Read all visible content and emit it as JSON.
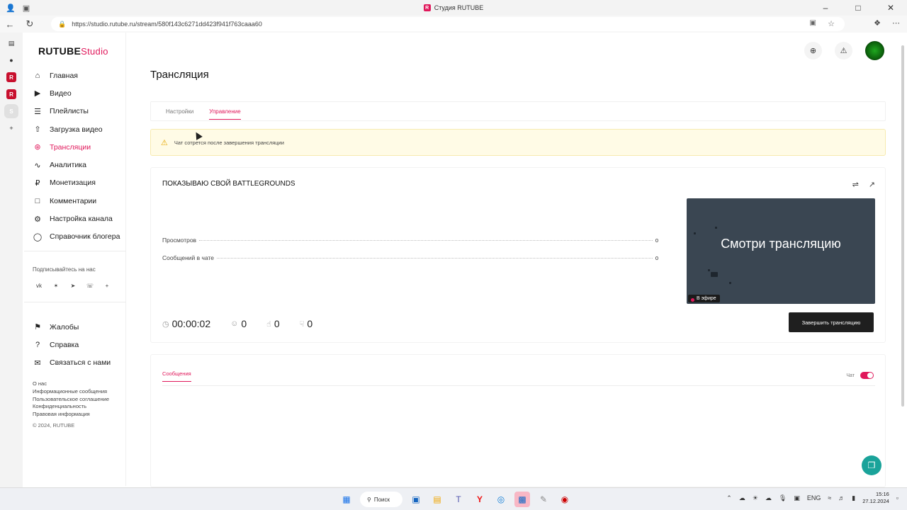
{
  "browser": {
    "tab_title": "Студия RUTUBE",
    "url": "https://studio.rutube.ru/stream/580f143c6271dd423f941f763caaa60"
  },
  "logo": {
    "brand": "RUTUBE",
    "product": "Studio"
  },
  "sidebar": {
    "items": [
      {
        "label": "Главная",
        "icon": "home-icon"
      },
      {
        "label": "Видео",
        "icon": "video-icon"
      },
      {
        "label": "Плейлисты",
        "icon": "playlist-icon"
      },
      {
        "label": "Загрузка видео",
        "icon": "upload-icon"
      },
      {
        "label": "Трансляции",
        "icon": "broadcast-icon",
        "active": true
      },
      {
        "label": "Аналитика",
        "icon": "analytics-icon"
      },
      {
        "label": "Монетизация",
        "icon": "monetization-icon"
      },
      {
        "label": "Комментарии",
        "icon": "comments-icon"
      },
      {
        "label": "Настройка канала",
        "icon": "channel-settings-icon"
      },
      {
        "label": "Справочник блогера",
        "icon": "blogger-guide-icon"
      }
    ],
    "subscribe_label": "Подписывайтесь на нас",
    "socials": [
      "vk",
      "ok",
      "telegram",
      "viber",
      "more"
    ],
    "secondary_items": [
      {
        "label": "Жалобы",
        "icon": "flag-icon"
      },
      {
        "label": "Справка",
        "icon": "help-icon"
      },
      {
        "label": "Связаться с нами",
        "icon": "mail-icon"
      }
    ],
    "footer_links": [
      "О нас",
      "Информационные сообщения",
      "Пользовательское соглашение",
      "Конфиденциальность",
      "Правовая информация"
    ],
    "copyright": "© 2024, RUTUBE"
  },
  "page": {
    "title": "Трансляция",
    "tabs": [
      {
        "label": "Настройки",
        "active": false
      },
      {
        "label": "Управление",
        "active": true
      }
    ],
    "warning": "Чат сотрется после завершения трансляции"
  },
  "stream": {
    "title": "ПОКАЗЫВАЮ СВОЙ BATTLEGROUNDS",
    "stats": [
      {
        "label": "Просмотров",
        "value": "0"
      },
      {
        "label": "Сообщений в чате",
        "value": "0"
      }
    ],
    "preview_text": "Смотри трансляцию",
    "live_badge": "В эфире",
    "duration": "00:00:02",
    "viewers": "0",
    "likes": "0",
    "dislikes": "0",
    "end_button": "Завершить трансляцию"
  },
  "chat": {
    "tab_label": "Сообщения",
    "toggle_label": "Чат",
    "toggle_on": true
  },
  "taskbar": {
    "search_label": "Поиск",
    "lang": "ENG",
    "time": "15:16",
    "date": "27.12.2024"
  },
  "colors": {
    "accent": "#e0185b",
    "warning_bg": "#fffbe6",
    "preview_bg": "#3a4652",
    "button_dark": "#1f1f1f",
    "fab": "#1aa39a"
  }
}
